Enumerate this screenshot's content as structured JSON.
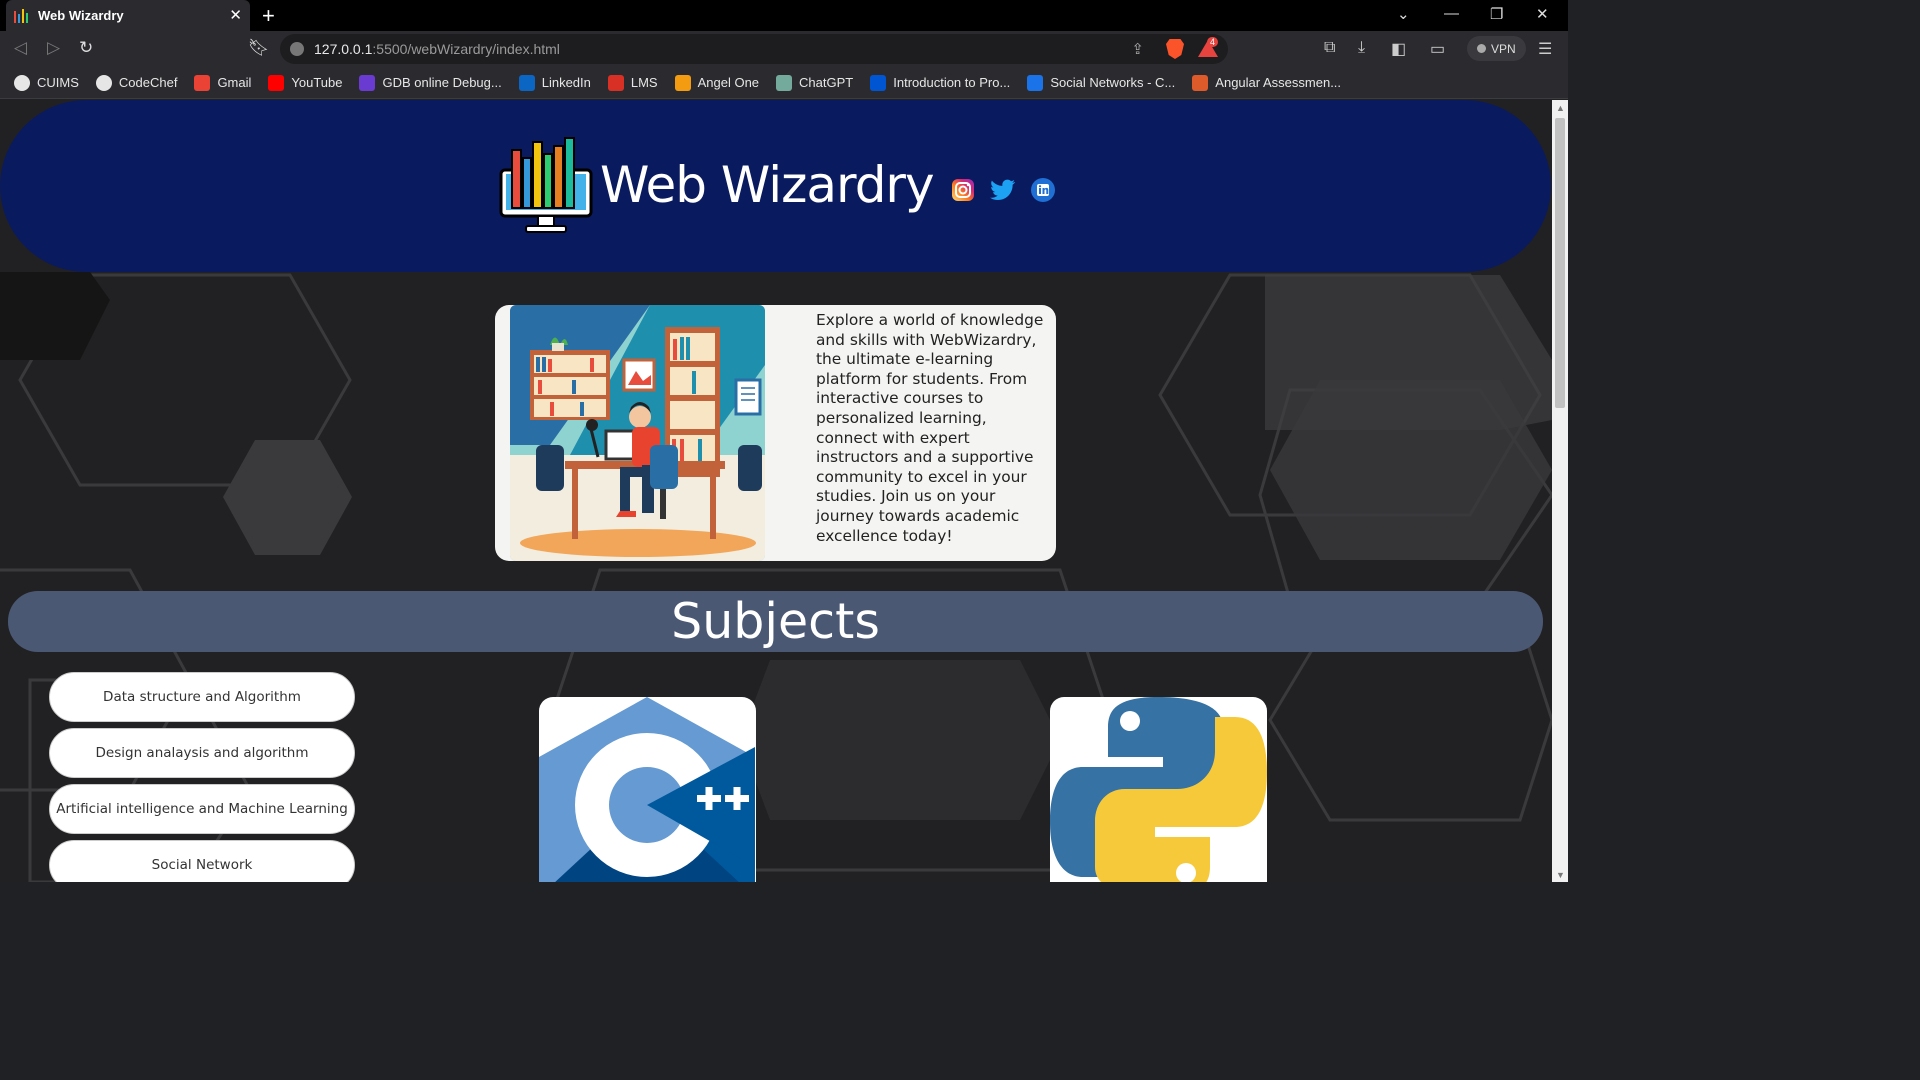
{
  "browser": {
    "tab_title": "Web Wizardry",
    "url_host": "127.0.0.1",
    "url_path": ":5500/webWizardry/index.html",
    "vpn_label": "VPN",
    "rewards_count": "4",
    "bookmarks": [
      {
        "label": "CUIMS",
        "icon": "globe-icon",
        "color": "#e6e6e6"
      },
      {
        "label": "CodeChef",
        "icon": "globe-icon",
        "color": "#e6e6e6"
      },
      {
        "label": "Gmail",
        "icon": "gmail-icon",
        "color": "#ea4335"
      },
      {
        "label": "YouTube",
        "icon": "youtube-icon",
        "color": "#ff0000"
      },
      {
        "label": "GDB online Debug...",
        "icon": "gdb-icon",
        "color": "#6a3bd1"
      },
      {
        "label": "LinkedIn",
        "icon": "linkedin-icon",
        "color": "#0a66c2"
      },
      {
        "label": "LMS",
        "icon": "lms-icon",
        "color": "#d93025"
      },
      {
        "label": "Angel One",
        "icon": "angel-one-icon",
        "color": "#f39c12"
      },
      {
        "label": "ChatGPT",
        "icon": "chatgpt-icon",
        "color": "#74aa9c"
      },
      {
        "label": "Introduction to Pro...",
        "icon": "coursera-icon",
        "color": "#0056d2"
      },
      {
        "label": "Social Networks - C...",
        "icon": "swayam-icon",
        "color": "#1a73e8"
      },
      {
        "label": "Angular Assessmen...",
        "icon": "angular-icon",
        "color": "#dd5a2b"
      }
    ]
  },
  "header": {
    "site_title": "Web Wizardry",
    "social_icons": [
      "instagram-icon",
      "twitter-icon",
      "linkedin-icon"
    ]
  },
  "intro": {
    "text": "Explore a world of knowledge and skills with WebWizardry, the ultimate e-learning platform for students. From interactive courses to personalized learning, connect with expert instructors and a supportive community to excel in your studies. Join us on your journey towards academic excellence today!"
  },
  "subjects": {
    "title": "Subjects",
    "items": [
      "Data structure and Algorithm",
      "Design analaysis and algorithm",
      "Artificial intelligence and Machine Learning",
      "Social Network"
    ],
    "language_cards": [
      "cpp-logo",
      "python-logo"
    ]
  },
  "colors": {
    "hero_bg": "#0a1a5e",
    "subjects_bar": "#4b5874",
    "page_bg": "#212123"
  }
}
